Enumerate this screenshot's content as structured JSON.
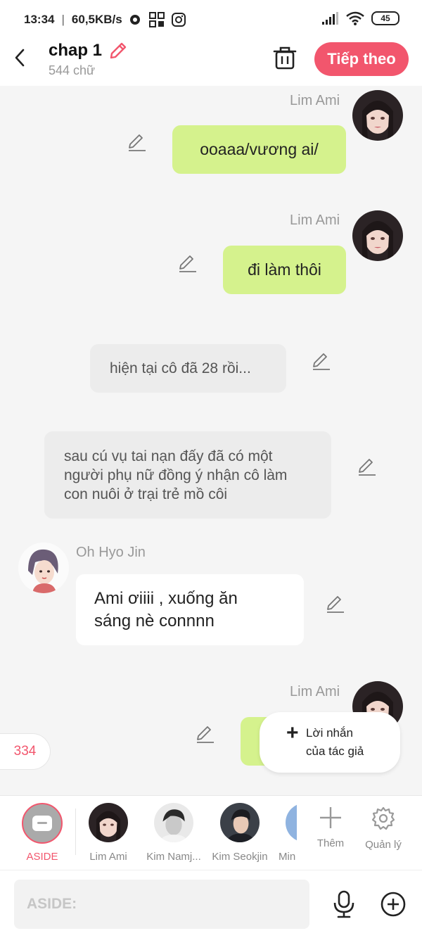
{
  "status_bar": {
    "time": "13:34",
    "speed": "60,5KB/s",
    "battery": "45"
  },
  "header": {
    "title": "chap 1",
    "subtitle": "544 chữ",
    "next_label": "Tiếp theo"
  },
  "messages": [
    {
      "sender": "Lim Ami",
      "text": "ooaaa/vương ai/"
    },
    {
      "sender": "Lim Ami",
      "text": "đi làm thôi"
    },
    {
      "text": "hiện tại cô đã 28 rồi..."
    },
    {
      "line1": "sau cú vụ tai nạn đấy đã có một",
      "line2": "người phụ nữ đồng ý nhận cô làm",
      "line3": "con nuôi ở trại trẻ mồ côi"
    },
    {
      "sender": "Oh Hyo Jin",
      "line1": "Ami ơiiii , xuống ăn",
      "line2": "sáng nè connnn"
    },
    {
      "sender": "Lim Ami"
    }
  ],
  "author_note": {
    "line1": "Lời nhắn",
    "line2": "của tác giả"
  },
  "counter": "334",
  "characters": [
    {
      "label": "ASIDE"
    },
    {
      "label": "Lim Ami"
    },
    {
      "label": "Kim Namj..."
    },
    {
      "label": "Kim Seokjin"
    },
    {
      "label": "Min"
    }
  ],
  "tools": {
    "add_label": "Thêm",
    "manage_label": "Quản lý"
  },
  "input": {
    "placeholder": "ASIDE:"
  },
  "colors": {
    "accent": "#f2566d",
    "user_bubble": "#d5f28d",
    "narration_bubble": "#ececec"
  }
}
